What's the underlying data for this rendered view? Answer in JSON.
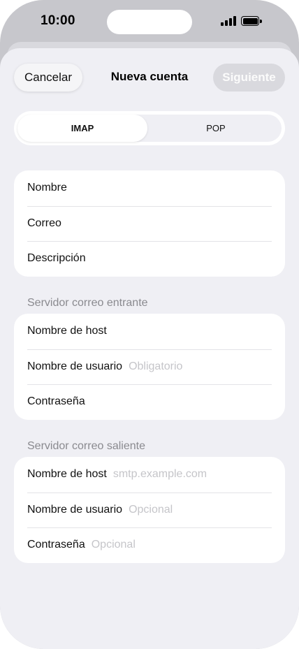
{
  "status_bar": {
    "time": "10:00"
  },
  "nav": {
    "cancel_label": "Cancelar",
    "title": "Nueva cuenta",
    "next_label": "Siguiente"
  },
  "segmented": {
    "options": [
      "IMAP",
      "POP"
    ],
    "selected": "IMAP"
  },
  "account_group": {
    "rows": [
      {
        "label": "Nombre",
        "placeholder": ""
      },
      {
        "label": "Correo",
        "placeholder": ""
      },
      {
        "label": "Descripción",
        "placeholder": ""
      }
    ]
  },
  "incoming": {
    "header": "Servidor correo entrante",
    "rows": [
      {
        "label": "Nombre de host",
        "placeholder": ""
      },
      {
        "label": "Nombre de usuario",
        "placeholder": "Obligatorio"
      },
      {
        "label": "Contraseña",
        "placeholder": ""
      }
    ]
  },
  "outgoing": {
    "header": "Servidor correo saliente",
    "rows": [
      {
        "label": "Nombre de host",
        "placeholder": "smtp.example.com"
      },
      {
        "label": "Nombre de usuario",
        "placeholder": "Opcional"
      },
      {
        "label": "Contraseña",
        "placeholder": "Opcional"
      }
    ]
  },
  "colors": {
    "sheet_bg": "#efeff4",
    "card_bg": "#ffffff",
    "placeholder": "#c5c5c9",
    "section_header": "#8a8a8f",
    "disabled_button": "#d9d9de"
  }
}
